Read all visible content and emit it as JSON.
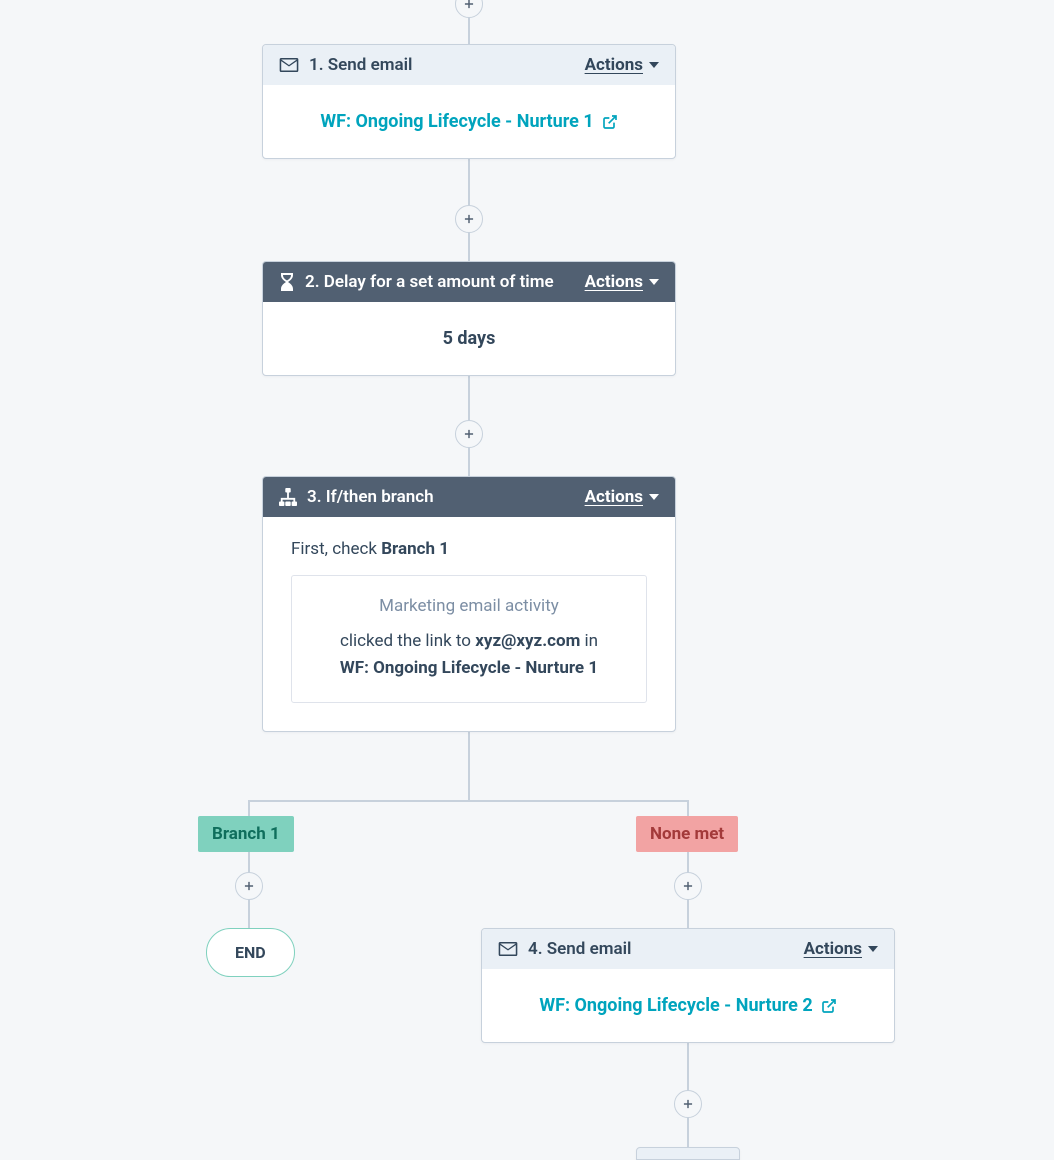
{
  "actions_label": "Actions",
  "nodes": {
    "s1": {
      "title": "1. Send email",
      "link": "WF: Ongoing Lifecycle - Nurture 1"
    },
    "s2": {
      "title": "2. Delay for a set amount of time",
      "value": "5 days"
    },
    "s3": {
      "title": "3. If/then branch",
      "first_check_prefix": "First, check ",
      "first_check_branch": "Branch 1",
      "condition": {
        "title": "Marketing email activity",
        "prefix": "clicked the link to ",
        "email": "xyz@xyz.com",
        "middle": " in ",
        "asset": "WF: Ongoing Lifecycle - Nurture 1"
      }
    },
    "s4": {
      "title": "4. Send email",
      "link": "WF: Ongoing Lifecycle - Nurture 2"
    }
  },
  "branches": {
    "left_label": "Branch 1",
    "right_label": "None met",
    "end_label": "END"
  }
}
